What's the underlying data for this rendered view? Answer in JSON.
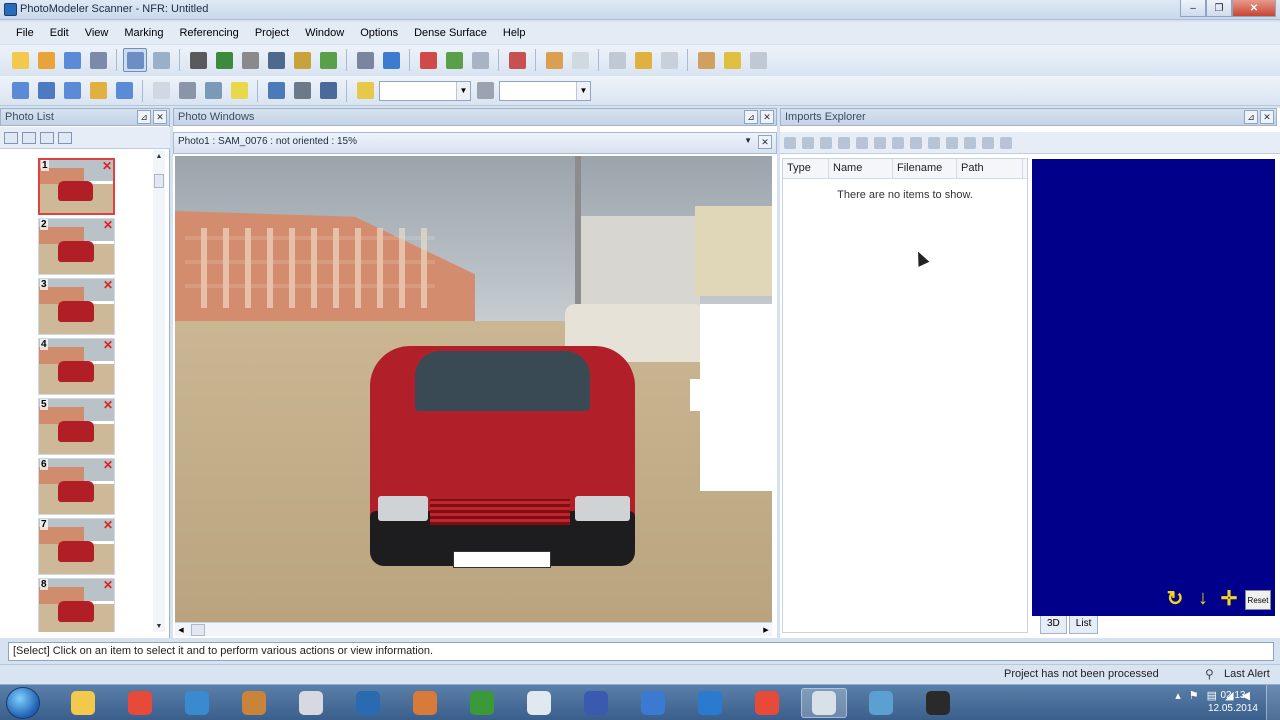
{
  "window": {
    "title": "PhotoModeler Scanner - NFR: Untitled",
    "buttons": [
      "–",
      "❐",
      "✕"
    ]
  },
  "menu": [
    "File",
    "Edit",
    "View",
    "Marking",
    "Referencing",
    "Project",
    "Window",
    "Options",
    "Dense Surface",
    "Help"
  ],
  "toolbar1": {
    "icons": [
      "new-project-icon",
      "open-project-icon",
      "save-icon",
      "undo-icon",
      "select-tool-icon",
      "magnify-select-icon",
      "point-tool-icon",
      "sub-pixel-point-icon",
      "line-tool-icon",
      "curve-tool-icon",
      "cylinder-tool-icon",
      "surface-tool-icon",
      "edge-tool-icon",
      "measure-tool-icon",
      "reference-tool-icon",
      "process-icon",
      "check-icon",
      "move-icon",
      "idealize-icon",
      "table-icon",
      "marking-icon",
      "dense-icon",
      "texture-icon",
      "export-icon",
      "import-icon",
      "grid-icon"
    ],
    "colors": [
      "#f2c94c",
      "#e8a43a",
      "#5b8bd6",
      "#7a8aa8",
      "#6c8ec4",
      "#9ab0c8",
      "#5a5a5a",
      "#3c8a3c",
      "#8a8a8a",
      "#4d6a8e",
      "#c8a23a",
      "#5aa04a",
      "#7a86a0",
      "#3c7bd0",
      "#d04a4a",
      "#5aa04a",
      "#a8b4c4",
      "#c85050",
      "#d8a050",
      "#d0d8e0",
      "#c0c8d4",
      "#e0b040",
      "#c8d0dc",
      "#d0a060",
      "#e0c040",
      "#c0c8d4"
    ]
  },
  "toolbar2": {
    "icons": [
      "view-2d-icon",
      "view-3d-icon",
      "view-photo-icon",
      "view-table-icon",
      "view-quality-icon",
      "layout-icon",
      "window-icon",
      "tile-icon",
      "color-bar-icon",
      "zoom-icon",
      "zoom-fit-icon",
      "grid-view-icon"
    ],
    "colors": [
      "#5b8bd6",
      "#4d7ac0",
      "#5b8bd6",
      "#e0b040",
      "#5b8bd6",
      "#d0d8e4",
      "#8a96a8",
      "#7a9ab8",
      "#e8d84a",
      "#4a7ab8",
      "#6a7a8a",
      "#4a6a9a"
    ],
    "combo1": "",
    "combo2": ""
  },
  "photo_list": {
    "title": "Photo List",
    "photos": [
      {
        "num": "1",
        "selected": true
      },
      {
        "num": "2",
        "selected": false
      },
      {
        "num": "3",
        "selected": false
      },
      {
        "num": "4",
        "selected": false
      },
      {
        "num": "5",
        "selected": false
      },
      {
        "num": "6",
        "selected": false
      },
      {
        "num": "7",
        "selected": false
      },
      {
        "num": "8",
        "selected": false
      }
    ]
  },
  "photo_windows": {
    "title": "Photo Windows",
    "subtitle": "Photo1 : SAM_0076 : not oriented : 15%"
  },
  "imports_explorer": {
    "title": "Imports Explorer",
    "columns": [
      "Type",
      "Name",
      "Filename",
      "Path"
    ],
    "empty_message": "There are no items to show.",
    "view_tabs": [
      "3D",
      "List"
    ],
    "reset_label": "Reset"
  },
  "status": {
    "message": "[Select] Click on an item to select it and to perform various actions or view information.",
    "project_state": "Project has not been processed",
    "alert": "Last Alert"
  },
  "taskbar": {
    "apps": [
      "explorer-icon",
      "chrome-icon",
      "app-star-icon",
      "app-swirl-icon",
      "app-dx-icon",
      "app-search-icon",
      "app-book-icon",
      "app-globe-green-icon",
      "app-line-icon",
      "app-m-icon",
      "app-ball-icon",
      "app-earth-icon",
      "app-chrome2-icon",
      "photomodeler-icon",
      "app-calc-icon",
      "app-camera-icon"
    ],
    "colors": [
      "#f2c94c",
      "#e84a3a",
      "#3a8ad0",
      "#c8843a",
      "#d8d8e0",
      "#2a6ab0",
      "#d87a3a",
      "#3a9a3a",
      "#e0e8f0",
      "#3a5ab0",
      "#3a7ad0",
      "#2a7ad0",
      "#e84a3a",
      "#d8e0e8",
      "#5aa0d0",
      "#2a2a2a"
    ],
    "active_index": 13,
    "clock_time": "02:13",
    "clock_date": "12.05.2014"
  }
}
